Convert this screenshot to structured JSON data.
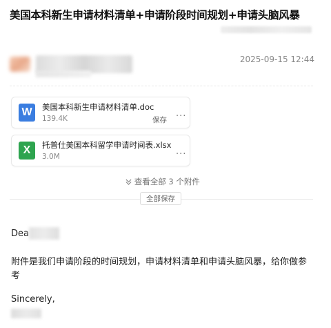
{
  "email": {
    "subject": "美国本科新生申请材料清单+申请阶段时间规划+申请头脑风暴",
    "date": "2025-09-15 12:44"
  },
  "attachments": [
    {
      "name": "美国本科新生申请材料清单.doc",
      "size": "139.4K",
      "save_label": "保存",
      "more_label": "···",
      "icon_letter": "W",
      "icon": "word-file-icon",
      "color": "#3a7de0"
    },
    {
      "name": "托普仕美国本科留学申请时间表.xlsx",
      "size": "3.0M",
      "more_label": "···",
      "icon_letter": "X",
      "icon": "excel-file-icon",
      "color": "#2ea44f"
    }
  ],
  "attachments_bar": {
    "view_all_label": "查看全部 3 个附件",
    "save_all_label": "全部保存"
  },
  "body": {
    "greeting": "Dea",
    "paragraph": "附件是我们申请阶段的时间规划，申请材料清单和申请头脑风暴，给你做参考",
    "closing": "Sincerely,"
  }
}
